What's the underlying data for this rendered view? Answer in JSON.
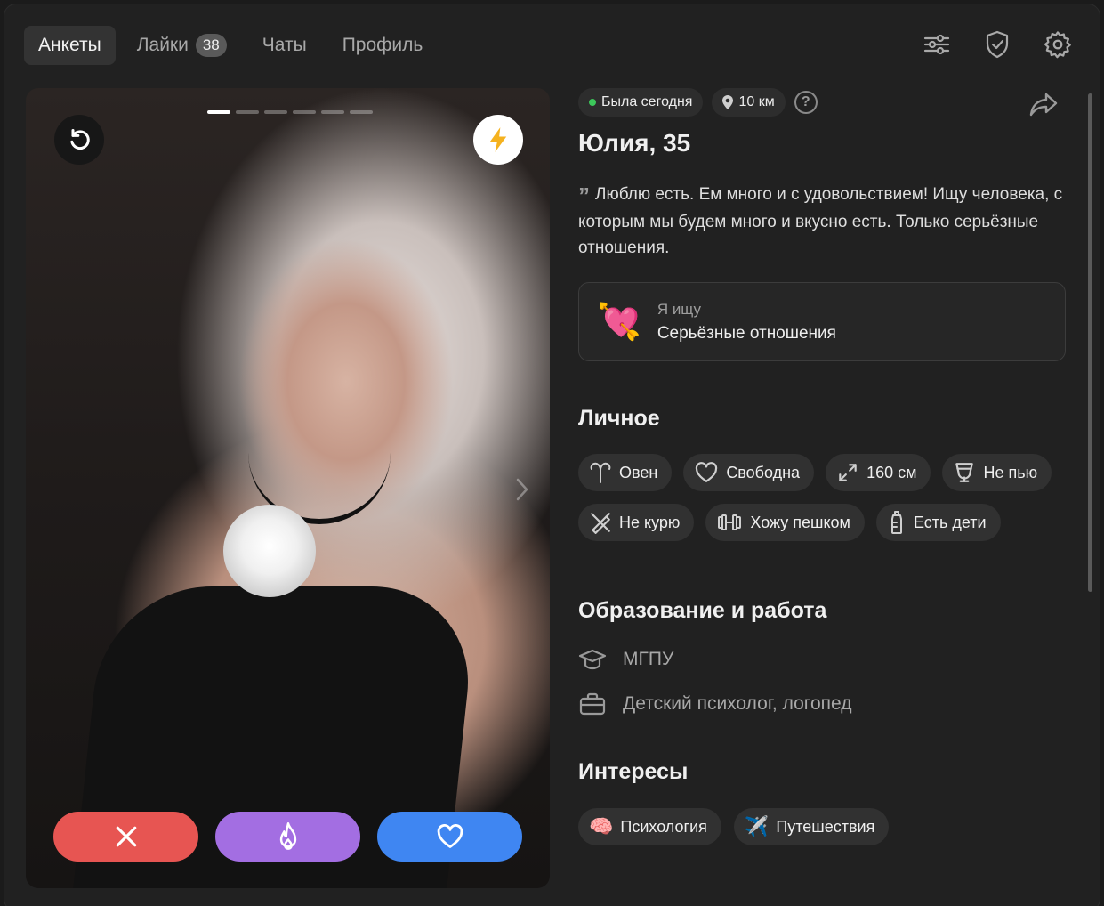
{
  "nav": {
    "tabs": [
      {
        "label": "Анкеты",
        "active": true
      },
      {
        "label": "Лайки",
        "badge": "38"
      },
      {
        "label": "Чаты"
      },
      {
        "label": "Профиль"
      }
    ],
    "icons": [
      "filters-icon",
      "shield-check-icon",
      "gear-icon"
    ]
  },
  "photo": {
    "slides_total": 6,
    "slide_current": 1,
    "buttons": [
      "rewind-icon",
      "boost-icon",
      "close-icon",
      "fire-icon",
      "heart-icon"
    ],
    "colors": {
      "dislike": "#e75552",
      "superlike": "#a36ee2",
      "like": "#3f86f2",
      "boost_bolt": "#f5b21f"
    }
  },
  "profile": {
    "status": "Была сегодня",
    "distance": "10 км",
    "help": "?",
    "name_age": "Юлия, 35",
    "about": "Люблю есть. Ем много и с удовольствием! Ищу человека, с которым мы будем много и вкусно есть. Только серьёзные отношения.",
    "seeking": {
      "label": "Я ищу",
      "value": "Серьёзные отношения",
      "emoji": "💘"
    }
  },
  "personal": {
    "title": "Личное",
    "tags": [
      {
        "icon": "aries-icon",
        "label": "Овен"
      },
      {
        "icon": "heart-outline-icon",
        "label": "Свободна"
      },
      {
        "icon": "height-icon",
        "label": "160 см"
      },
      {
        "icon": "glass-icon",
        "label": "Не пью"
      },
      {
        "icon": "no-smoking-icon",
        "label": "Не курю"
      },
      {
        "icon": "dumbbell-icon",
        "label": "Хожу пешком"
      },
      {
        "icon": "baby-bottle-icon",
        "label": "Есть дети"
      }
    ]
  },
  "education": {
    "title": "Образование и работа",
    "school": "МГПУ",
    "job": "Детский психолог, логопед"
  },
  "interests": {
    "title": "Интересы",
    "tags": [
      {
        "emoji": "🧠",
        "label": "Психология"
      },
      {
        "emoji": "✈️",
        "label": "Путешествия"
      }
    ]
  }
}
